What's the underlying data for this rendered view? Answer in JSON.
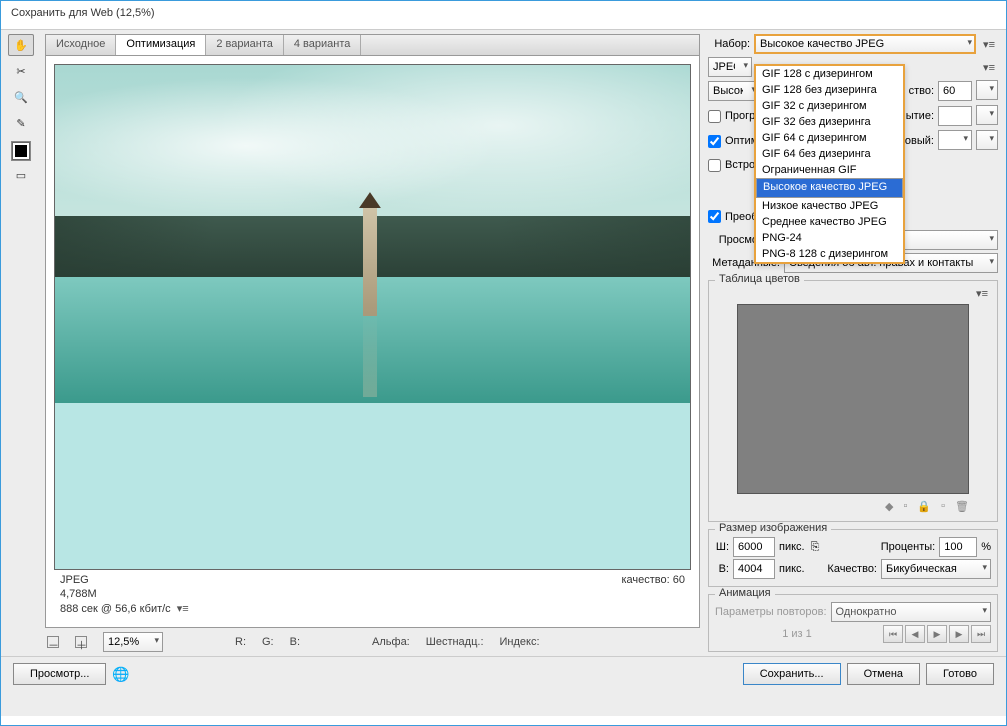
{
  "window": {
    "title": "Сохранить для Web (12,5%)"
  },
  "tabs": {
    "t0": "Исходное",
    "t1": "Оптимизация",
    "t2": "2 варианта",
    "t3": "4 варианта"
  },
  "status": {
    "fmt": "JPEG",
    "size": "4,788M",
    "time": "888 сек @ 56,6 кбит/с",
    "q_label": "качество: 60"
  },
  "meta": {
    "r": "R:",
    "g": "G:",
    "b": "B:",
    "alpha": "Альфа:",
    "hex": "Шестнадц.:",
    "index": "Индекс:"
  },
  "preset": {
    "label": "Набор:",
    "value": "Высокое качество JPEG",
    "options": {
      "o0": "GIF 128 с дизерингом",
      "o1": "GIF 128 без дизеринга",
      "o2": "GIF 32 с дизерингом",
      "o3": "GIF 32 без дизеринга",
      "o4": "GIF 64 с дизерингом",
      "o5": "GIF 64 без дизеринга",
      "o6": "Ограниченная GIF",
      "o7": "Высокое качество JPEG",
      "o8": "Низкое качество JPEG",
      "o9": "Среднее качество JPEG",
      "o10": "PNG-24",
      "o11": "PNG-8 128 с дизерингом"
    }
  },
  "opts": {
    "jpeg": "JPEG",
    "quality_preset": "Высоко",
    "progr": "Прогрессивная",
    "opt": "Оптимизированная",
    "embed": "Встроенный профиль",
    "qual_lbl": "ство:",
    "qual_val": "60",
    "blur_lbl": "ытие:",
    "matte_lbl": "овый:"
  },
  "convert": {
    "preo": "Преобразовать в sRGB"
  },
  "view": {
    "label": "Просмотр:",
    "value": "Цвет монитора"
  },
  "metadata": {
    "label": "Метаданные:",
    "value": "Сведения об авт. правах и контакты"
  },
  "palette": {
    "title": "Таблица цветов"
  },
  "size": {
    "title": "Размер изображения",
    "w_lbl": "Ш:",
    "w": "6000",
    "px": "пикс.",
    "h_lbl": "В:",
    "h": "4004",
    "pct_lbl": "Проценты:",
    "pct": "100",
    "pct_s": "%",
    "q_lbl": "Качество:",
    "q_val": "Бикубическая"
  },
  "anim": {
    "title": "Анимация",
    "loop_lbl": "Параметры повторов:",
    "loop_val": "Однократно",
    "pos": "1 из 1"
  },
  "zoom": {
    "val": "12,5%"
  },
  "buttons": {
    "preview": "Просмотр...",
    "save": "Сохранить...",
    "cancel": "Отмена",
    "done": "Готово"
  }
}
